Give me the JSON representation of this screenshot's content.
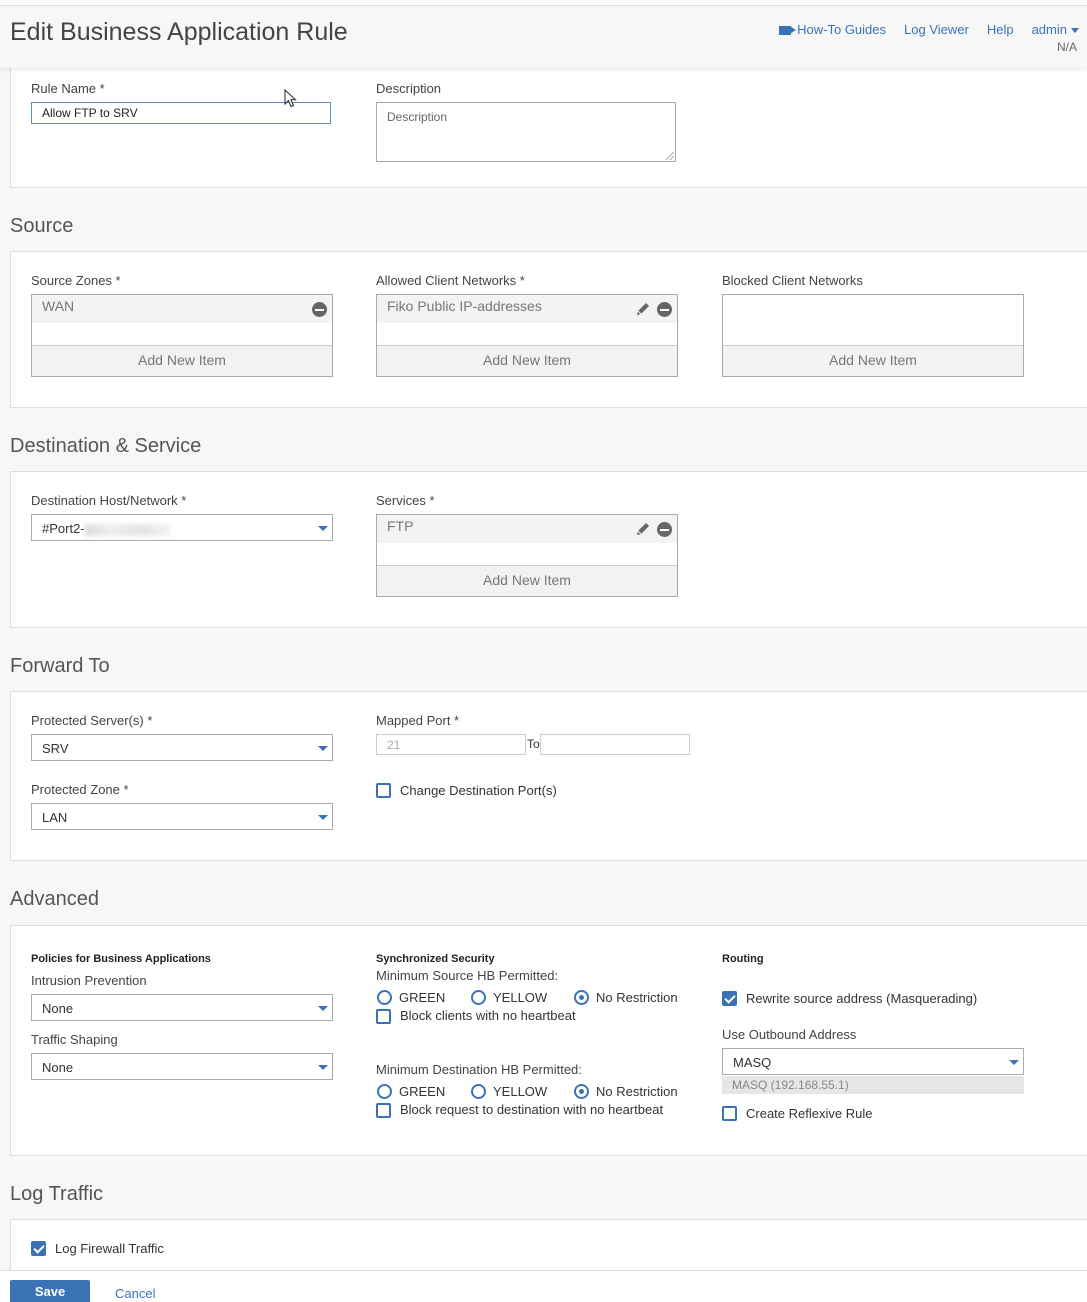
{
  "header": {
    "title": "Edit Business Application Rule",
    "nav": {
      "how_to": "How-To Guides",
      "log_viewer": "Log Viewer",
      "help": "Help",
      "user": "admin",
      "na": "N/A"
    }
  },
  "rule": {
    "name_label": "Rule Name *",
    "name_value": "Allow FTP to SRV",
    "desc_label": "Description",
    "desc_placeholder": "Description"
  },
  "source": {
    "title": "Source",
    "zones_label": "Source Zones *",
    "zones_items": [
      "WAN"
    ],
    "allowed_label": "Allowed Client Networks *",
    "allowed_items": [
      "Fiko Public IP-addresses"
    ],
    "blocked_label": "Blocked Client Networks",
    "add_new": "Add New Item"
  },
  "destination": {
    "title": "Destination & Service",
    "host_label": "Destination Host/Network *",
    "host_value": "#Port2-",
    "services_label": "Services *",
    "services_items": [
      "FTP"
    ],
    "add_new": "Add New Item"
  },
  "forward": {
    "title": "Forward To",
    "server_label": "Protected Server(s) *",
    "server_value": "SRV",
    "zone_label": "Protected Zone *",
    "zone_value": "LAN",
    "mapped_label": "Mapped Port *",
    "mapped_from": "21",
    "mapped_to_label": "To",
    "change_dest_label": "Change Destination Port(s)"
  },
  "advanced": {
    "title": "Advanced",
    "policies_label": "Policies for Business Applications",
    "ips_label": "Intrusion Prevention",
    "ips_value": "None",
    "shaping_label": "Traffic Shaping",
    "shaping_value": "None",
    "sync_label": "Synchronized Security",
    "min_source_label": "Minimum Source HB Permitted:",
    "min_dest_label": "Minimum Destination HB Permitted:",
    "green": "GREEN",
    "yellow": "YELLOW",
    "no_restriction": "No Restriction",
    "block_clients": "Block clients with no heartbeat",
    "block_request": "Block request to destination with no heartbeat",
    "routing_label": "Routing",
    "rewrite_label": "Rewrite source address (Masquerading)",
    "outbound_label": "Use Outbound Address",
    "outbound_value": "MASQ",
    "outbound_info": "MASQ (192.168.55.1)",
    "reflexive_label": "Create Reflexive Rule"
  },
  "log": {
    "title": "Log Traffic",
    "log_fw_label": "Log Firewall Traffic"
  },
  "footer": {
    "save": "Save",
    "cancel": "Cancel"
  },
  "colors": {
    "accent": "#3a72b6"
  }
}
